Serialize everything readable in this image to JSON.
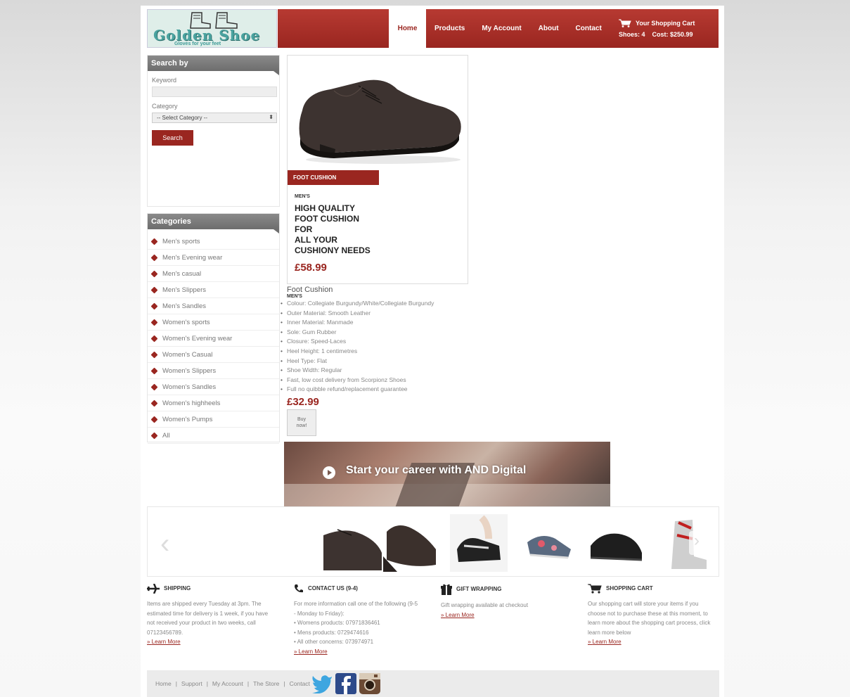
{
  "header": {
    "logo_brand": "Golden Shoe",
    "logo_tagline": "Gloves for your feet",
    "nav": [
      "Home",
      "Products",
      "My Account",
      "About",
      "Contact"
    ],
    "cart_label": "Your Shopping Cart",
    "cart_summary": "Shoes: 4    Cost: $250.99"
  },
  "search": {
    "heading": "Search by",
    "keyword_label": "Keyword",
    "keyword_value": "",
    "category_label": "Category",
    "category_selected": "-- Select Category --",
    "button": "Search"
  },
  "categories": {
    "heading": "Categories",
    "items": [
      "Men's sports",
      "Men's Evening wear",
      "Men's casual",
      "Men's Slippers",
      "Men's Sandles",
      "Women's sports",
      "Women's Evening wear",
      "Women's Casual",
      "Women's Slippers",
      "Women's Sandles",
      "Women's highheels",
      "Women's Pumps",
      "All"
    ]
  },
  "product_card": {
    "badge": "FOOT CUSHION",
    "gender": "MEN'S",
    "title": "HIGH QUALITY\nFOOT CUSHION\nFOR\nALL YOUR\nCUSHIONY NEEDS",
    "price": "£58.99"
  },
  "details": {
    "title": "Foot Cushion",
    "gender": "MEN'S",
    "specs": [
      "Colour: Collegiate Burgundy/White/Collegiate Burgundy",
      "Outer Material: Smooth Leather",
      "Inner Material: Manmade",
      "Sole: Gum Rubber",
      "Closure: Speed-Laces",
      "Heel Height: 1 centimetres",
      "Heel Type: Flat",
      "Shoe Width: Regular",
      "Fast, low cost delivery from Scorpionz Shoes",
      "Full no quibble refund/replacement guarantee"
    ],
    "price": "£32.99",
    "buy_label": "Buy\nnow!"
  },
  "video": {
    "text": "Start your career with AND Digital"
  },
  "info": {
    "shipping": {
      "heading": "SHIPPING",
      "text": "Items are shipped every Tuesday at 3pm. The estimated time for delivery is 1 week, if you have not received your product in two weeks, call 07123456789.",
      "link": "Learn More"
    },
    "contact": {
      "heading": "CONTACT US (9-4)",
      "text": "For more information call one of the following (9-5 - Monday to Friday):",
      "items": [
        "Womens products: 07971836461",
        "Mens products: 0729474616",
        "All other concerns: 073974971"
      ],
      "link": "Learn More"
    },
    "gift": {
      "heading": "GIFT WRAPPING",
      "text": "Gift wrapping available at checkout",
      "link": "Learn More"
    },
    "cart": {
      "heading": "SHOPPING CART",
      "text": "Our shopping cart will store your items if you choose not to purchase these at this moment, to learn more about the shopping cart process, click learn more below",
      "link": "Learn More"
    }
  },
  "footer": {
    "links": [
      "Home",
      "Support",
      "My Account",
      "The Store",
      "Contact"
    ]
  },
  "colors": {
    "brand_red": "#9a2620",
    "panel_grey": "#7a7a7a",
    "logo_teal": "#4aa3a0"
  }
}
